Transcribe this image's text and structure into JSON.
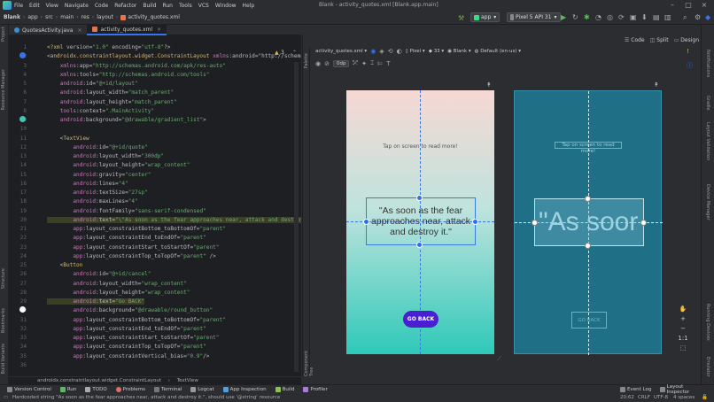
{
  "menubar": {
    "items": [
      "File",
      "Edit",
      "View",
      "Navigate",
      "Code",
      "Refactor",
      "Build",
      "Run",
      "Tools",
      "VCS",
      "Window",
      "Help"
    ],
    "title": "Blank - activity_quotes.xml [Blank.app.main]"
  },
  "navbar": {
    "crumbs": [
      "Blank",
      "app",
      "src",
      "main",
      "res",
      "layout",
      "activity_quotes.xml"
    ],
    "run_config": "app",
    "device": "Pixel 5 API 31"
  },
  "left_strip": [
    "Project",
    "Resource Manager",
    "Structure",
    "Bookmarks",
    "Build Variants"
  ],
  "tabs": [
    {
      "label": "QuotesActivity.java",
      "active": false
    },
    {
      "label": "activity_quotes.xml",
      "active": true
    }
  ],
  "warning_count": "3",
  "code_lines": [
    {
      "n": "1",
      "text": "<?xml version=\"1.0\" encoding=\"utf-8\"?>"
    },
    {
      "n": "2",
      "text": "<androidx.constraintlayout.widget.ConstraintLayout xmlns:android=\"http://schemas.android.c"
    },
    {
      "n": "3",
      "text": "    xmlns:app=\"http://schemas.android.com/apk/res-auto\""
    },
    {
      "n": "4",
      "text": "    xmlns:tools=\"http://schemas.android.com/tools\""
    },
    {
      "n": "5",
      "text": "    android:id=\"@+id/layout\""
    },
    {
      "n": "6",
      "text": "    android:layout_width=\"match_parent\""
    },
    {
      "n": "7",
      "text": "    android:layout_height=\"match_parent\""
    },
    {
      "n": "8",
      "text": "    tools:context=\".MainActivity\""
    },
    {
      "n": "9",
      "text": "    android:background=\"@drawable/gradient_list\">"
    },
    {
      "n": "10",
      "text": ""
    },
    {
      "n": "11",
      "text": "    <TextView"
    },
    {
      "n": "12",
      "text": "        android:id=\"@+id/quote\""
    },
    {
      "n": "13",
      "text": "        android:layout_width=\"300dp\""
    },
    {
      "n": "14",
      "text": "        android:layout_height=\"wrap_content\""
    },
    {
      "n": "15",
      "text": "        android:gravity=\"center\""
    },
    {
      "n": "16",
      "text": "        android:lines=\"4\""
    },
    {
      "n": "17",
      "text": "        android:textSize=\"27sp\""
    },
    {
      "n": "18",
      "text": "        android:maxLines=\"4\""
    },
    {
      "n": "19",
      "text": "        android:fontFamily=\"sans-serif-condensed\""
    },
    {
      "n": "20",
      "text": "        android:text=\"\\\"As soon as the fear approaches near, attack and destroy it.\\\"\""
    },
    {
      "n": "21",
      "text": "        app:layout_constraintBottom_toBottomOf=\"parent\""
    },
    {
      "n": "22",
      "text": "        app:layout_constraintEnd_toEndOf=\"parent\""
    },
    {
      "n": "23",
      "text": "        app:layout_constraintStart_toStartOf=\"parent\""
    },
    {
      "n": "24",
      "text": "        app:layout_constraintTop_toTopOf=\"parent\" />"
    },
    {
      "n": "25",
      "text": "    <Button"
    },
    {
      "n": "26",
      "text": "        android:id=\"@+id/cancel\""
    },
    {
      "n": "27",
      "text": "        android:layout_width=\"wrap_content\""
    },
    {
      "n": "28",
      "text": "        android:layout_height=\"wrap_content\""
    },
    {
      "n": "29",
      "text": "        android:text=\"Go BACK\""
    },
    {
      "n": "30",
      "text": "        android:background=\"@drawable/round_button\""
    },
    {
      "n": "31",
      "text": "        app:layout_constraintBottom_toBottomOf=\"parent\""
    },
    {
      "n": "32",
      "text": "        app:layout_constraintEnd_toEndOf=\"parent\""
    },
    {
      "n": "33",
      "text": "        app:layout_constraintStart_toStartOf=\"parent\""
    },
    {
      "n": "34",
      "text": "        app:layout_constraintTop_toTopOf=\"parent\""
    },
    {
      "n": "35",
      "text": "        app:layout_constraintVertical_bias=\"0.9\"/>"
    },
    {
      "n": "36",
      "text": ""
    }
  ],
  "editor_breadcrumb": [
    "androidx.constraintlayout.widget.ConstraintLayout",
    "TextView"
  ],
  "design": {
    "modes": [
      "Code",
      "Split",
      "Design"
    ],
    "file_dropdown": "activity_quotes.xml",
    "device_dropdown": "Pixel",
    "api_dropdown": "33",
    "theme_dropdown": "Blank",
    "locale_dropdown": "Default (en-us)",
    "margin": "0dp",
    "palette_label": "Palette",
    "component_tree_label": "Component Tree",
    "preview": {
      "tap_text": "Tap on screen to read more!",
      "quote": "\"As soon as the fear approaches near, attack and destroy it.\"",
      "button": "GO BACK",
      "blueprint_quote": "\"As soor",
      "blueprint_button": "GO BACK"
    }
  },
  "right_strip": [
    "Notifications",
    "Gradle",
    "Layout Validation",
    "Device Manager",
    "Running Devices",
    "Emulator"
  ],
  "bottom_bar": [
    "Version Control",
    "Run",
    "TODO",
    "Problems",
    "Terminal",
    "Logcat",
    "App Inspection",
    "Build",
    "Profiler",
    "Event Log",
    "Layout Inspector"
  ],
  "status": {
    "message": "Hardcoded string \"As soon as the fear approaches near, attack and destroy it.\", should use '@string' resource",
    "position": "20:62",
    "line_ending": "CRLF",
    "encoding": "UTF-8",
    "indent": "4 spaces"
  }
}
